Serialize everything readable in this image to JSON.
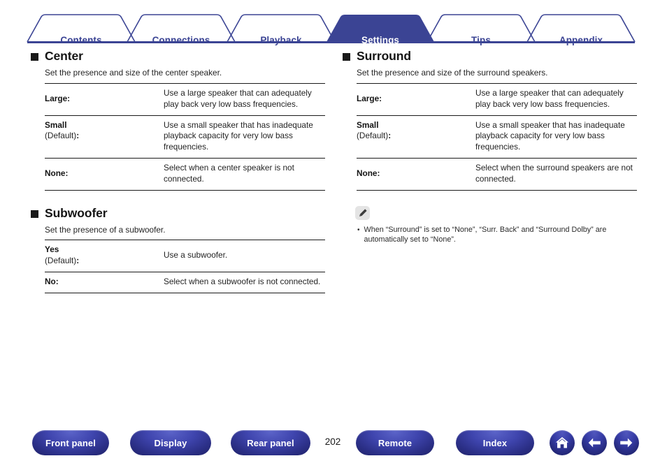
{
  "tabs": [
    {
      "label": "Contents",
      "active": false
    },
    {
      "label": "Connections",
      "active": false
    },
    {
      "label": "Playback",
      "active": false
    },
    {
      "label": "Settings",
      "active": true
    },
    {
      "label": "Tips",
      "active": false
    },
    {
      "label": "Appendix",
      "active": false
    }
  ],
  "colors": {
    "tab_accent": "#3b4494",
    "tab_active_bg": "#3b4494",
    "button_blue": "#3f45ae",
    "button_dark": "#22256e",
    "text": "#1a1a1a"
  },
  "left_column": {
    "sections": [
      {
        "title": "Center",
        "description": "Set the presence and size of the center speaker.",
        "rows": [
          {
            "key": "Large",
            "default_label": "",
            "value": "Use a large speaker that can adequately play back very low bass frequencies."
          },
          {
            "key": "Small",
            "default_label": "(Default)",
            "value": "Use a small speaker that has inadequate playback capacity for very low bass frequencies."
          },
          {
            "key": "None",
            "default_label": "",
            "value": "Select when a center speaker is not connected."
          }
        ]
      },
      {
        "title": "Subwoofer",
        "description": "Set the presence of a subwoofer.",
        "rows": [
          {
            "key": "Yes",
            "default_label": "(Default)",
            "value": "Use a subwoofer."
          },
          {
            "key": "No",
            "default_label": "",
            "value": "Select when a subwoofer is not connected."
          }
        ]
      }
    ]
  },
  "right_column": {
    "sections": [
      {
        "title": "Surround",
        "description": "Set the presence and size of the surround speakers.",
        "rows": [
          {
            "key": "Large",
            "default_label": "",
            "value": "Use a large speaker that can adequately play back very low bass frequencies."
          },
          {
            "key": "Small",
            "default_label": "(Default)",
            "value": "Use a small speaker that has inadequate playback capacity for very low bass frequencies."
          },
          {
            "key": "None",
            "default_label": "",
            "value": "Select when the surround speakers are not connected."
          }
        ]
      }
    ],
    "note": {
      "icon": "pencil-icon",
      "bullet": "•",
      "text": "When “Surround” is set to “None”, “Surr. Back” and “Surround Dolby” are automatically set to “None”."
    }
  },
  "footer": {
    "buttons": [
      {
        "label": "Front panel"
      },
      {
        "label": "Display"
      },
      {
        "label": "Rear panel"
      },
      {
        "label": "Remote"
      },
      {
        "label": "Index"
      }
    ],
    "page_number": "202",
    "icons": [
      {
        "name": "home-icon"
      },
      {
        "name": "arrow-left-icon"
      },
      {
        "name": "arrow-right-icon"
      }
    ]
  }
}
